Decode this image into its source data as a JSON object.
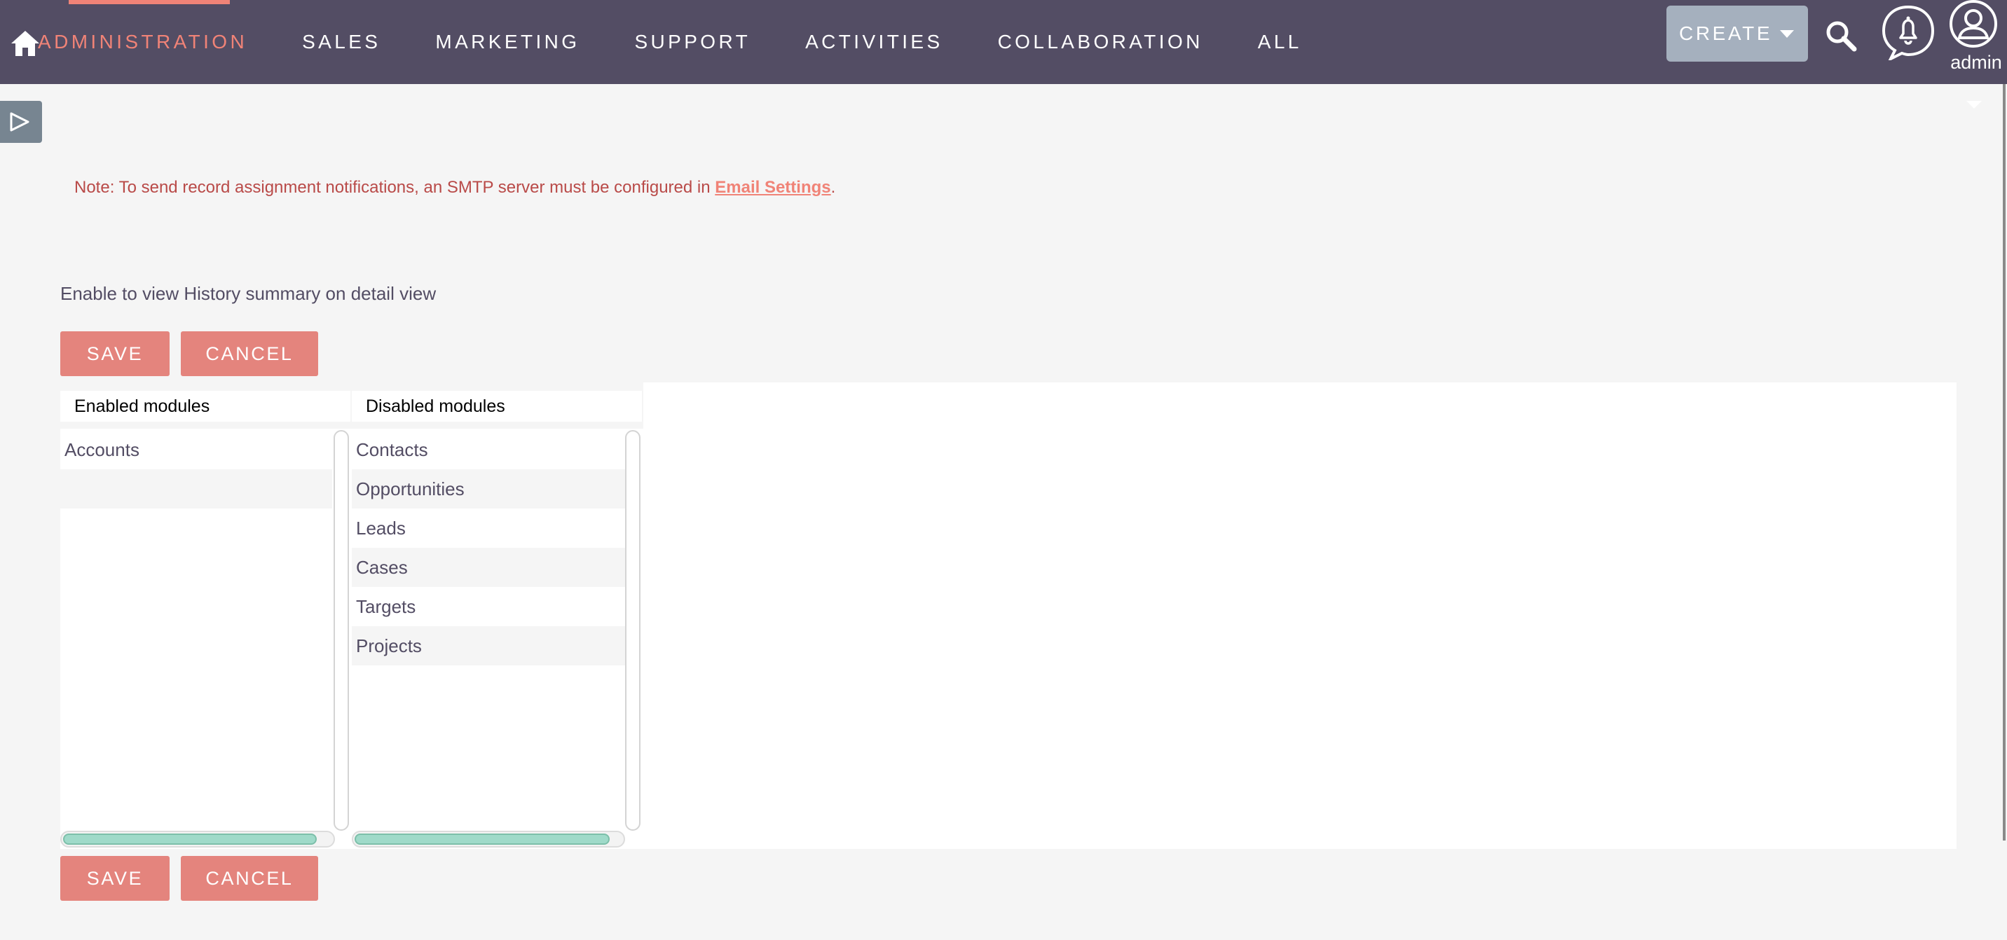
{
  "nav": {
    "items": [
      {
        "label": "ADMINISTRATION",
        "active": true
      },
      {
        "label": "SALES",
        "active": false
      },
      {
        "label": "MARKETING",
        "active": false
      },
      {
        "label": "SUPPORT",
        "active": false
      },
      {
        "label": "ACTIVITIES",
        "active": false
      },
      {
        "label": "COLLABORATION",
        "active": false
      },
      {
        "label": "ALL",
        "active": false
      }
    ],
    "create_label": "CREATE",
    "user_label": "admin"
  },
  "icons": {
    "home": "home-icon",
    "search": "search-icon",
    "notifications": "bell-icon",
    "user": "user-icon",
    "sidebar_toggle": "play-icon",
    "dropdown": "chevron-down-icon"
  },
  "note": {
    "prefix": "Note: To send record assignment notifications, an SMTP server must be configured in ",
    "link": "Email Settings",
    "suffix": "."
  },
  "description": "Enable to view History summary on detail view",
  "buttons": {
    "save": "SAVE",
    "cancel": "CANCEL"
  },
  "enabled": {
    "header": "Enabled modules",
    "items": [
      "Accounts"
    ]
  },
  "disabled": {
    "header": "Disabled modules",
    "items": [
      "Contacts",
      "Opportunities",
      "Leads",
      "Cases",
      "Targets",
      "Projects"
    ]
  },
  "colors": {
    "nav_bg": "#534d64",
    "accent": "#f08377",
    "button": "#e4847d",
    "create_bg": "#a5b0be",
    "scroll_thumb": "#9fdac9",
    "note_text": "#b94a48"
  }
}
